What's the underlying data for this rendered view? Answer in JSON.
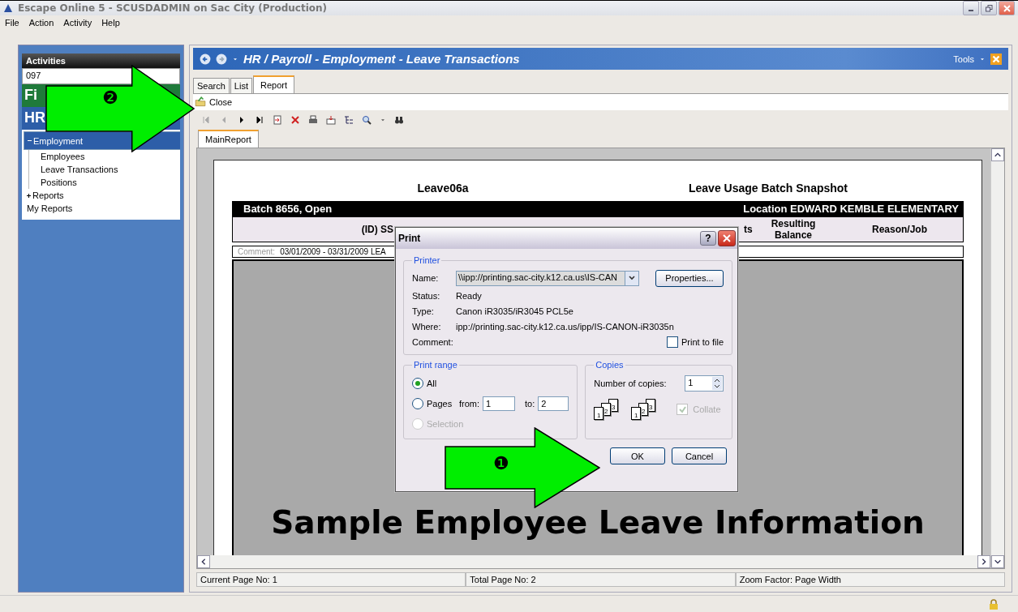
{
  "window": {
    "title": "Escape Online 5 - SCUSDADMIN on Sac City (Production)"
  },
  "menu": [
    "File",
    "Action",
    "Activity",
    "Help"
  ],
  "sidebar": {
    "title": "Activities",
    "district": "097",
    "sections": [
      {
        "label": "Fi",
        "color": "#1f7a3a"
      },
      {
        "label": "HR",
        "color": "#2d5ea8"
      }
    ],
    "tree": [
      {
        "label": "Employment",
        "expanded": true,
        "selected": true,
        "children": [
          {
            "label": "Employees",
            "selected": false
          },
          {
            "label": "Leave Transactions",
            "selected": false
          },
          {
            "label": "Positions",
            "selected": false
          }
        ]
      },
      {
        "label": "Reports",
        "expanded": false,
        "selected": false
      },
      {
        "label": "My Reports",
        "selected": false
      }
    ]
  },
  "header": {
    "title": "HR / Payroll - Employment - Leave Transactions",
    "tools": "Tools"
  },
  "tabs": [
    {
      "label": "Search",
      "selected": false
    },
    {
      "label": "List",
      "selected": false
    },
    {
      "label": "Report",
      "selected": true
    }
  ],
  "close_label": "Close",
  "report_tabs": [
    {
      "label": "MainReport",
      "selected": true
    }
  ],
  "report": {
    "title_left": "Leave06a",
    "title_right": "Leave Usage Batch Snapshot",
    "batch": "Batch 8656, Open",
    "location": "Location EDWARD KEMBLE ELEMENTARY",
    "columns": [
      "(ID) SS",
      "ts",
      "Resulting Balance",
      "Reason/Job"
    ],
    "comment_label": "Comment:",
    "comment": "03/01/2009 - 03/31/2009 LEA"
  },
  "caption": "Sample Employee Leave Information",
  "status_bar": [
    "Current Page No: 1",
    "Total Page No: 2",
    "Zoom Factor: Page Width"
  ],
  "dialog": {
    "title": "Print",
    "help": "?",
    "printer": {
      "legend": "Printer",
      "name_label": "Name:",
      "name": "\\\\ipp://printing.sac-city.k12.ca.us\\IS-CAN",
      "properties": "Properties...",
      "info": [
        {
          "label": "Status:",
          "value": "Ready"
        },
        {
          "label": "Type:",
          "value": "Canon iR3035/iR3045 PCL5e"
        },
        {
          "label": "Where:",
          "value": "ipp://printing.sac-city.k12.ca.us/ipp/IS-CANON-iR3035n"
        },
        {
          "label": "Comment:"
        }
      ],
      "print_to_file": {
        "label": "Print to file",
        "checked": false
      }
    },
    "range": {
      "legend": "Print range",
      "options": [
        {
          "label": "All",
          "selected": true,
          "disabled": false
        },
        {
          "label": "Pages",
          "selected": false,
          "disabled": false
        },
        {
          "label": "Selection",
          "selected": false,
          "disabled": true
        }
      ],
      "from_label": "from:",
      "from": "1",
      "to_label": "to:",
      "to": "2"
    },
    "copies": {
      "legend": "Copies",
      "label": "Number of copies:",
      "value": "1",
      "stacks": [
        [
          "1",
          "2",
          "3"
        ],
        [
          "1",
          "2",
          "3"
        ]
      ],
      "collate": {
        "label": "Collate",
        "checked": true,
        "disabled": true
      }
    },
    "buttons": [
      "OK",
      "Cancel"
    ]
  },
  "annotations": [
    {
      "number": "❷"
    },
    {
      "number": "❶"
    }
  ]
}
